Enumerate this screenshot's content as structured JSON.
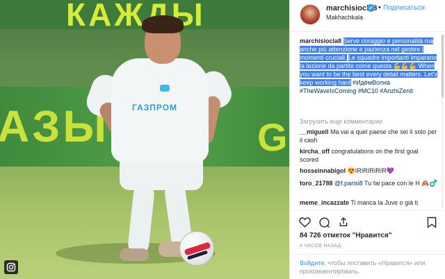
{
  "photo": {
    "board_top_text": "КАЖДЫ",
    "board_mid_text": "АЗЫВ",
    "board_mid_text2": "G",
    "sponsor_text": "ГАЗПРОМ",
    "badge_icon": "instagram-icon"
  },
  "header": {
    "username": "marchisiocla8",
    "verified_icon": "✔",
    "separator": "•",
    "follow_label": "Подписаться",
    "location": "Makhachkala"
  },
  "caption": {
    "user": "marchisiocla8",
    "hl1": "Serve coraggio e personalità ma anche più attenzione e pazienza nel gestire i momenti cruciali.",
    "hl2": "Le squadre importanti imparano la lezione da partite come questa 💪💪💪 When you want to be the best every detail matters. Let's keep working hard",
    "hashtags": "#ИдёмВолна #TheWaveIsComing #MC10 #AnzhiZenit"
  },
  "load_more": "Загрузить еще комментарии",
  "comments": [
    {
      "user": "__miguell",
      "text": "Ma vai a quel paese che sei lì solo per il cash"
    },
    {
      "user": "kircha_off",
      "text": "congratulations on the first goal scored"
    },
    {
      "user": "hosseinnabigol",
      "text": "😍IRIRIRIRIR💜"
    },
    {
      "user": "toro_21788",
      "mention": "@f.parisi8",
      "text": "Tu fai pace con le H 🙈♂️"
    },
    {
      "user": "meme_incazzate",
      "text": "Ti manca la Juve o già ti"
    }
  ],
  "actions": {
    "like_icon": "heart-icon",
    "comment_icon": "comment-icon",
    "share_icon": "share-icon",
    "save_icon": "bookmark-icon"
  },
  "likes_text": "84 726 отметок \"Нравится\"",
  "time_text": "4 ЧАСОВ НАЗАД",
  "footer": {
    "login_link": "Войдите",
    "rest": ", чтобы поставить «Нравится» или прокомментировать."
  },
  "colors": {
    "link": "#3897f0",
    "highlight": "#3d7ff0",
    "hashtag": "#003569"
  }
}
